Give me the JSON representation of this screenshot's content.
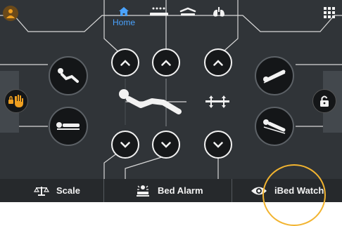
{
  "header": {
    "tabs": [
      {
        "label": "Home",
        "icon": "home-icon",
        "active": true
      },
      {
        "label": "",
        "icon": "bed-exit-icon",
        "active": false
      },
      {
        "label": "",
        "icon": "bed-incline-icon",
        "active": false
      },
      {
        "label": "",
        "icon": "lungs-icon",
        "active": false
      }
    ],
    "left_icon": "user-settings-icon",
    "right_icon": "grid-menu-icon"
  },
  "side": {
    "left_icon": "hand-lock-icon",
    "right_icon": "padlock-icon"
  },
  "positions": {
    "left_top": "chair-position-icon",
    "left_bottom": "flat-position-icon",
    "right_top": "trendelenburg-icon",
    "right_bottom": "reverse-trendelenburg-icon",
    "center_left": "patient-reclining-icon",
    "center_right": "bed-height-icon"
  },
  "bottom": {
    "scale_label": "Scale",
    "alarm_label": "Bed Alarm",
    "watch_label": "iBed Watch"
  },
  "colors": {
    "background": "#303438",
    "accent": "#4aa3ff",
    "highlight": "#f2b430",
    "icon_orange": "#f0a020"
  }
}
